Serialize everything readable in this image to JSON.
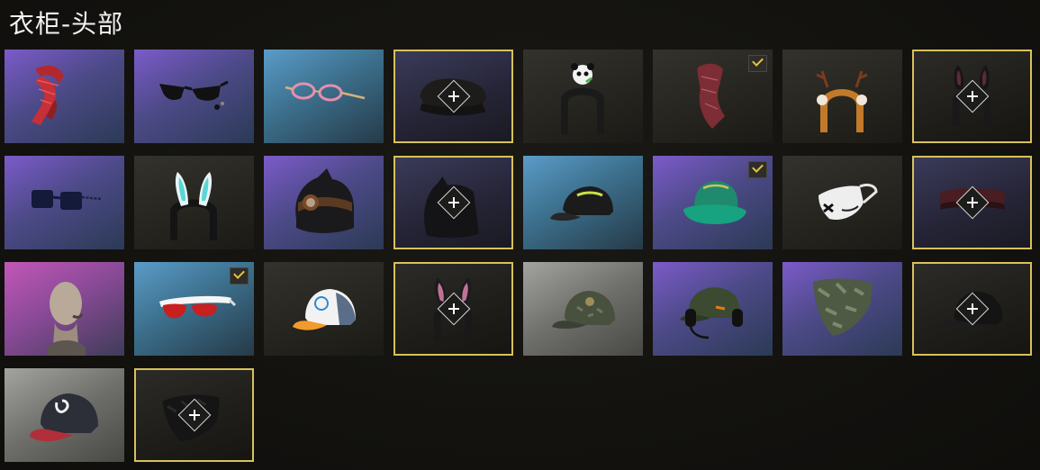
{
  "header": {
    "title": "衣柜-头部"
  },
  "colors": {
    "slot_border": "#d8c15b",
    "check": "#e4c340"
  },
  "items": [
    {
      "name": "red-scarf-icon",
      "bg": "purple"
    },
    {
      "name": "cat-eye-sunglasses-icon",
      "bg": "purple"
    },
    {
      "name": "pink-glasses-icon",
      "bg": "blue"
    },
    {
      "name": "military-cap-icon",
      "bg": "slot",
      "empty_slot": true
    },
    {
      "name": "panda-headband-icon",
      "bg": "dark"
    },
    {
      "name": "bandana-icon",
      "bg": "dark",
      "equipped": true
    },
    {
      "name": "antler-headband-icon",
      "bg": "dark"
    },
    {
      "name": "bunny-ears-icon",
      "bg": "slot-dark",
      "empty_slot": true
    },
    {
      "name": "square-sunglasses-icon",
      "bg": "purple"
    },
    {
      "name": "glowing-bunny-ears-icon",
      "bg": "dark"
    },
    {
      "name": "cat-beanie-goggles-icon",
      "bg": "purple"
    },
    {
      "name": "cat-hood-icon",
      "bg": "slot",
      "empty_slot": true
    },
    {
      "name": "baseball-cap-icon",
      "bg": "blue"
    },
    {
      "name": "bucket-hat-icon",
      "bg": "purple",
      "equipped": true
    },
    {
      "name": "face-mask-icon",
      "bg": "dark"
    },
    {
      "name": "headband-icon",
      "bg": "slot",
      "empty_slot": true
    },
    {
      "name": "bald-head-icon",
      "bg": "magenta"
    },
    {
      "name": "sport-sunglasses-icon",
      "bg": "blue",
      "equipped": true
    },
    {
      "name": "trucker-cap-icon",
      "bg": "dark"
    },
    {
      "name": "bunny-ears-icon",
      "bg": "slot-dark",
      "empty_slot": true
    },
    {
      "name": "camo-cap-icon",
      "bg": "grey"
    },
    {
      "name": "headset-cap-icon",
      "bg": "purple"
    },
    {
      "name": "camo-mask-icon",
      "bg": "purple"
    },
    {
      "name": "cap-icon",
      "bg": "slot-dark",
      "empty_slot": true
    },
    {
      "name": "red-cap-icon",
      "bg": "grey"
    },
    {
      "name": "mask-icon",
      "bg": "slot-dark",
      "empty_slot": true
    }
  ]
}
